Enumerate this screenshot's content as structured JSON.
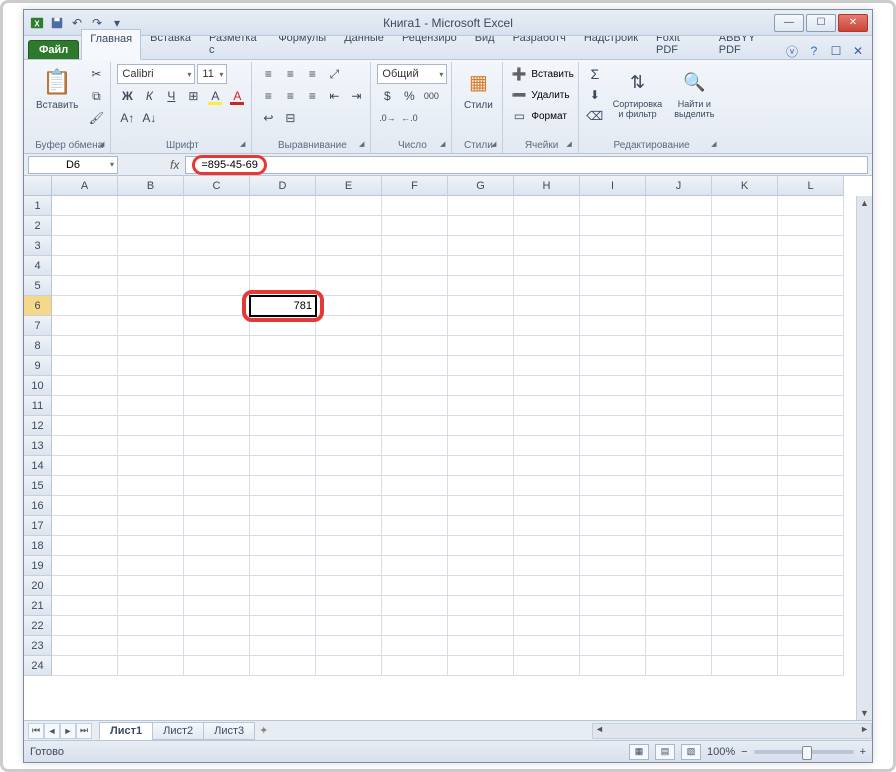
{
  "title": "Книга1 - Microsoft Excel",
  "tabs": {
    "file": "Файл",
    "items": [
      "Главная",
      "Вставка",
      "Разметка с",
      "Формулы",
      "Данные",
      "Рецензиро",
      "Вид",
      "Разработч",
      "Надстройк",
      "Foxit PDF",
      "ABBYY PDF"
    ],
    "activeIndex": 0
  },
  "ribbon": {
    "clipboard": {
      "paste": "Вставить",
      "label": "Буфер обмена"
    },
    "font": {
      "name": "Calibri",
      "size": "11",
      "label": "Шрифт",
      "bold": "Ж",
      "italic": "К",
      "underline": "Ч"
    },
    "align": {
      "label": "Выравнивание"
    },
    "number": {
      "format": "Общий",
      "label": "Число",
      "percent": "%",
      "thousands": "000"
    },
    "styles": {
      "label": "Стили",
      "btn": "Стили"
    },
    "cells": {
      "insert": "Вставить",
      "delete": "Удалить",
      "format": "Формат",
      "label": "Ячейки"
    },
    "editing": {
      "sort": "Сортировка\nи фильтр",
      "find": "Найти и\nвыделить",
      "label": "Редактирование",
      "sigma": "Σ"
    }
  },
  "namebox": "D6",
  "formula": "=895-45-69",
  "columns": [
    "A",
    "B",
    "C",
    "D",
    "E",
    "F",
    "G",
    "H",
    "I",
    "J",
    "K",
    "L"
  ],
  "rows": [
    "1",
    "2",
    "3",
    "4",
    "5",
    "6",
    "7",
    "8",
    "9",
    "10",
    "11",
    "12",
    "13",
    "14",
    "15",
    "16",
    "17",
    "18",
    "19",
    "20",
    "21",
    "22",
    "23",
    "24"
  ],
  "activeCell": {
    "row": 5,
    "col": 3,
    "value": "781"
  },
  "sheets": {
    "items": [
      "Лист1",
      "Лист2",
      "Лист3"
    ],
    "activeIndex": 0
  },
  "status": {
    "ready": "Готово",
    "zoom": "100%"
  }
}
